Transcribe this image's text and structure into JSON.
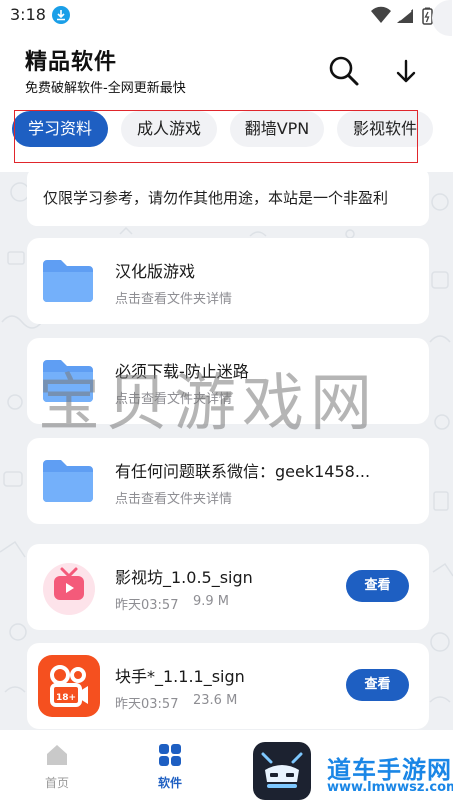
{
  "status_bar": {
    "time": "3:18"
  },
  "header": {
    "title": "精品软件",
    "subtitle": "免费破解软件-全网更新最快",
    "search_icon": "search-icon",
    "download_icon": "download-icon"
  },
  "tabs": [
    {
      "label": "学习资料",
      "active": true
    },
    {
      "label": "成人游戏",
      "active": false
    },
    {
      "label": "翻墙VPN",
      "active": false
    },
    {
      "label": "影视软件",
      "active": false
    }
  ],
  "notice": {
    "text": "仅限学习参考，请勿作其他用途，本站是一个非盈利"
  },
  "folders": [
    {
      "title": "汉化版游戏",
      "subtitle": "点击查看文件夹详情"
    },
    {
      "title": "必须下载-防止迷路",
      "subtitle": "点击查看文件夹详情"
    },
    {
      "title": "有任何问题联系微信：geek1458...",
      "subtitle": "点击查看文件夹详情"
    }
  ],
  "apps": [
    {
      "name": "影视坊_1.0.5_sign",
      "time": "昨天03:57",
      "size": "9.9 M",
      "button": "查看",
      "icon": "tv-app-icon",
      "icon_color": "#f45a7a"
    },
    {
      "name": "块手*_1.1.1_sign",
      "time": "昨天03:57",
      "size": "23.6 M",
      "button": "查看",
      "icon": "kuaishou-app-icon",
      "icon_color": "#f5501f"
    }
  ],
  "watermark": "宝贝游戏网",
  "bottom_nav": [
    {
      "label": "首页",
      "icon": "home-icon",
      "active": false
    },
    {
      "label": "软件",
      "icon": "grid-icon",
      "active": true
    }
  ],
  "brand": {
    "name": "道车手游网",
    "url": "www.lmwwsz.com"
  },
  "colors": {
    "accent": "#1e5fc2",
    "folder": "#6aa8f7",
    "brand": "#1a86e6"
  }
}
